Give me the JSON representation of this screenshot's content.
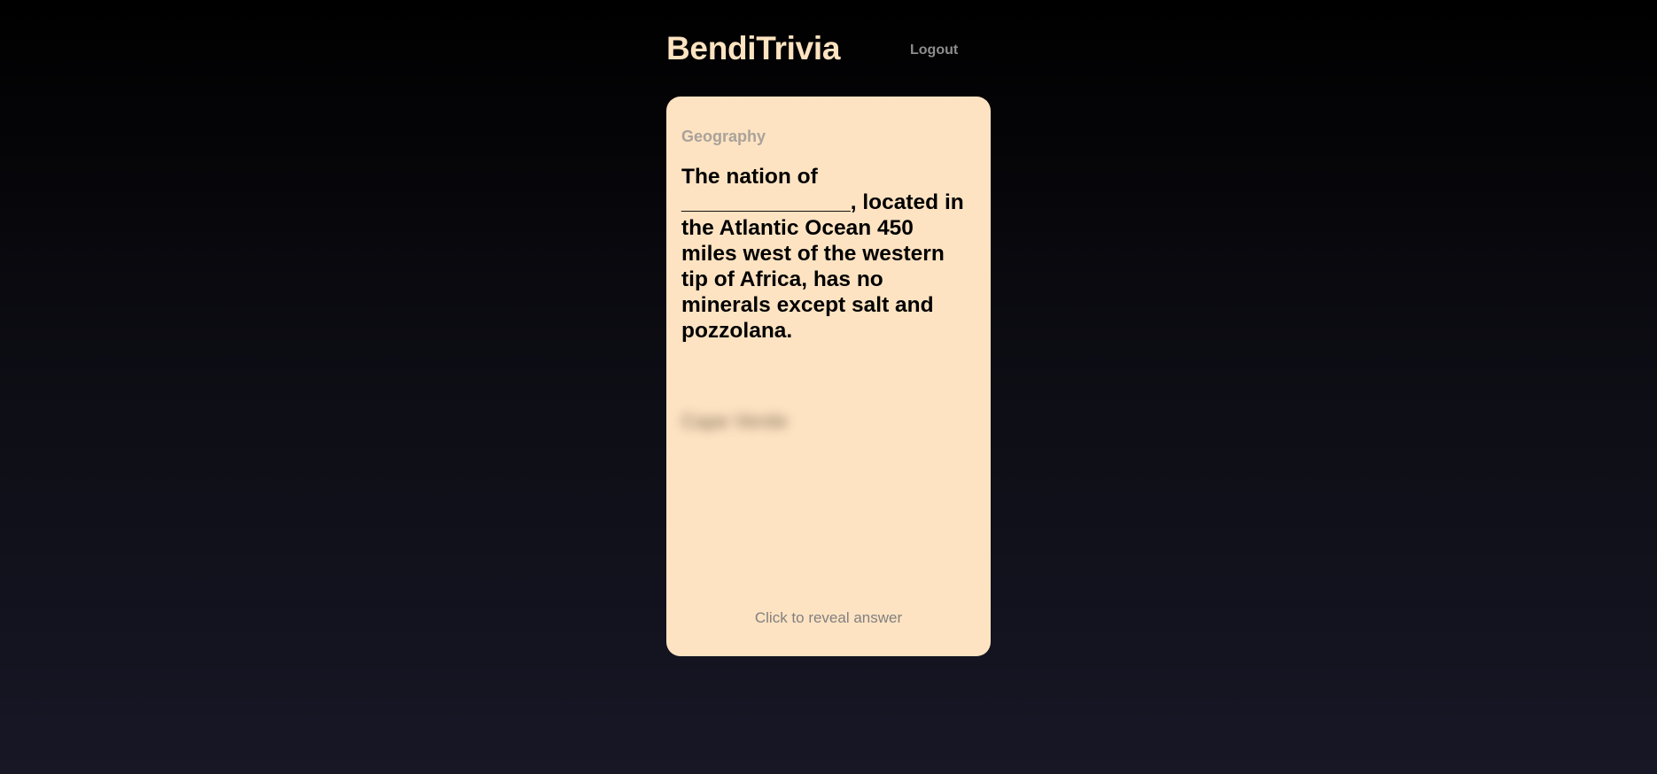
{
  "header": {
    "title": "BendiTrivia",
    "logout_label": "Logout"
  },
  "card": {
    "category": "Geography",
    "question": "The nation of ______________, located in the Atlantic Ocean 450 miles west of the western tip of Africa, has no minerals except salt and pozzolana.",
    "answer_hidden": "Cape Verde",
    "reveal_hint": "Click to reveal answer"
  },
  "colors": {
    "brand": "#fde3c0",
    "card_bg": "#fee3c2",
    "muted": "#808080"
  }
}
